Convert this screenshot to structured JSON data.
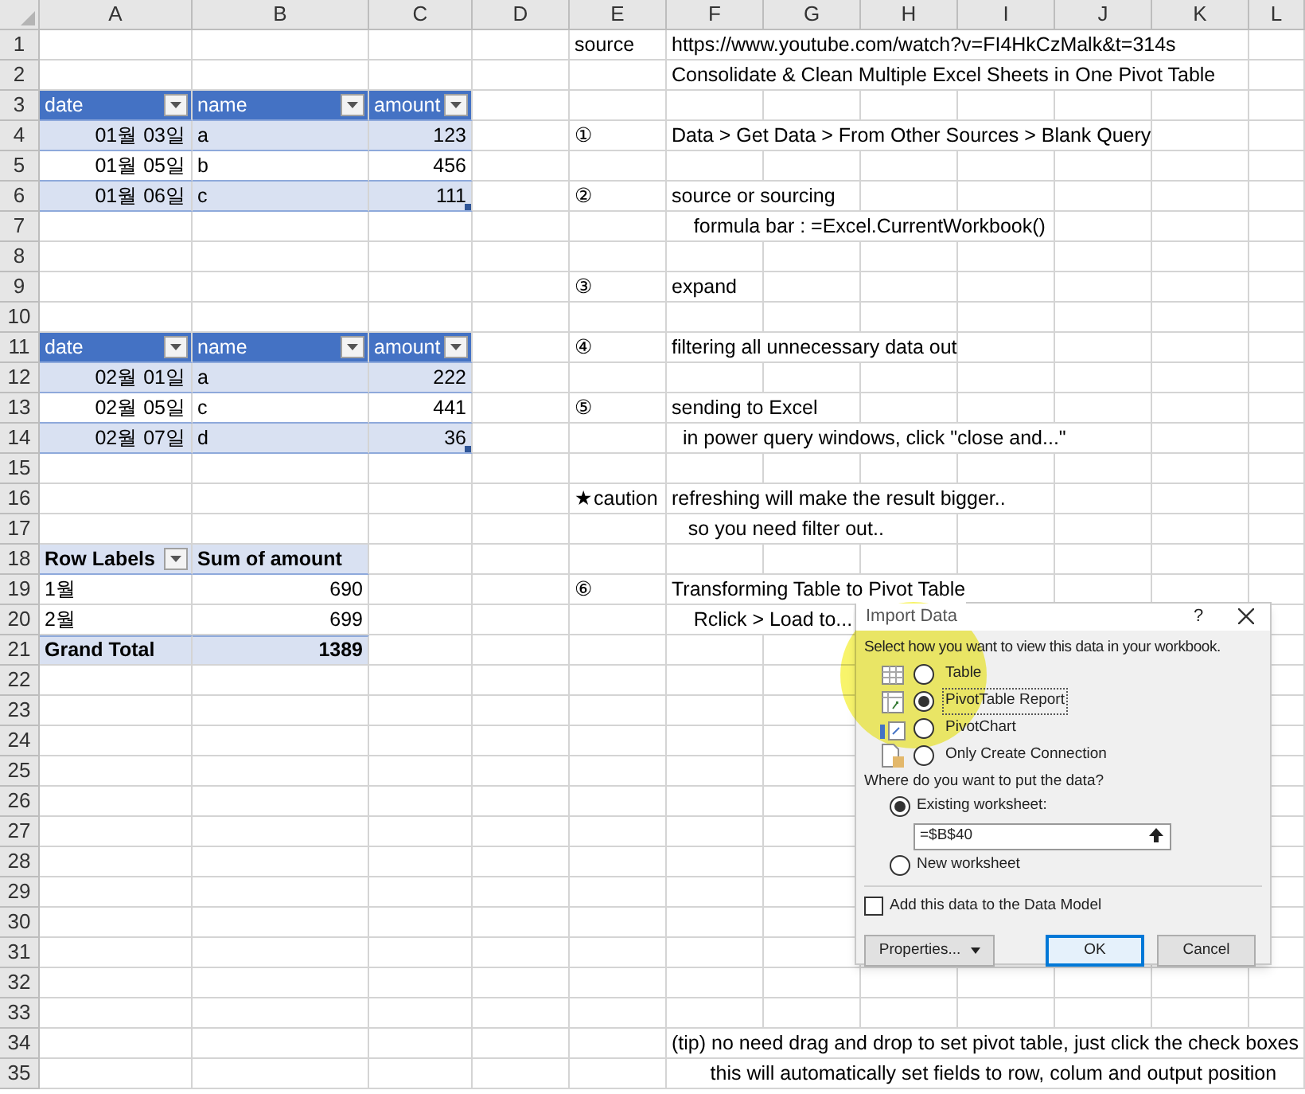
{
  "column_headers": [
    "A",
    "B",
    "C",
    "D",
    "E",
    "F",
    "G",
    "H",
    "I",
    "J",
    "K",
    "L"
  ],
  "row_numbers": [
    "1",
    "2",
    "3",
    "4",
    "5",
    "6",
    "7",
    "8",
    "9",
    "10",
    "11",
    "12",
    "13",
    "14",
    "15",
    "16",
    "17",
    "18",
    "19",
    "20",
    "21",
    "22",
    "23",
    "24",
    "25",
    "26",
    "27",
    "28",
    "29",
    "30",
    "31",
    "32",
    "33",
    "34",
    "35"
  ],
  "tables": [
    {
      "header": [
        {
          "label": "date",
          "filter": true
        },
        {
          "label": "name",
          "filter": true
        },
        {
          "label": "amount",
          "filter": true
        }
      ],
      "rows": [
        [
          "01월 03일",
          "a",
          "123"
        ],
        [
          "01월 05일",
          "b",
          "456"
        ],
        [
          "01월 06일",
          "c",
          "111"
        ]
      ]
    },
    {
      "header": [
        {
          "label": "date",
          "filter": true
        },
        {
          "label": "name",
          "filter": true
        },
        {
          "label": "amount",
          "filter": true
        }
      ],
      "rows": [
        [
          "02월 01일",
          "a",
          "222"
        ],
        [
          "02월 05일",
          "c",
          "441"
        ],
        [
          "02월 07일",
          "d",
          "36"
        ]
      ]
    }
  ],
  "pivot": {
    "header": [
      {
        "label": "Row Labels",
        "filter": true
      },
      {
        "label": "Sum of amount",
        "filter": false
      }
    ],
    "rows": [
      {
        "label": "1월",
        "value": "690"
      },
      {
        "label": "2월",
        "value": "699"
      }
    ],
    "total": {
      "label": "Grand Total",
      "value": "1389"
    }
  },
  "notes": [
    {
      "marker": "source",
      "text": "https://www.youtube.com/watch?v=FI4HkCzMalk&t=314s"
    },
    {
      "text": "Consolidate & Clean Multiple Excel Sheets in One Pivot Table"
    },
    {
      "marker": "①",
      "text": "Data > Get Data > From Other Sources > Blank Query"
    },
    {
      "marker": "②",
      "text": "source or sourcing"
    },
    {
      "text": "    formula bar : =Excel.CurrentWorkbook()"
    },
    {
      "marker": "③",
      "text": "expand"
    },
    {
      "marker": "④",
      "text": "filtering all unnecessary data out"
    },
    {
      "marker": "⑤",
      "text": "sending to Excel"
    },
    {
      "text": "  in power query windows, click \"close and...\""
    },
    {
      "marker": "★caution",
      "text": "refreshing will make the result bigger.."
    },
    {
      "text": "   so you need filter out.."
    },
    {
      "marker": "⑥",
      "text": "Transforming Table to Pivot Table"
    },
    {
      "text": "    Rclick > Load to..."
    },
    {
      "text": "(tip) no need drag and drop to set pivot table, just click the check boxes"
    },
    {
      "text": "       this will automatically set fields to row, colum and output position"
    }
  ],
  "dialog": {
    "title": "Import Data",
    "help": "?",
    "view_prompt": "Select how you want to view this data in your workbook.",
    "view_options": [
      {
        "label": "Table",
        "kind": "table",
        "selected": false
      },
      {
        "label": "PivotTable Report",
        "kind": "pivot-table",
        "selected": true
      },
      {
        "label": "PivotChart",
        "kind": "pivot-chart",
        "selected": false
      },
      {
        "label": "Only Create Connection",
        "kind": "connection",
        "selected": false
      }
    ],
    "location_prompt": "Where do you want to put the data?",
    "location_options": [
      {
        "label": "Existing worksheet:",
        "selected": true,
        "field": {
          "value": "=$B$40"
        }
      },
      {
        "label": "New worksheet",
        "selected": false
      }
    ],
    "data_model": {
      "label": "Add this data to the Data Model",
      "checked": false
    },
    "buttons": [
      {
        "label": "Properties...",
        "kind": "menu"
      },
      {
        "label": "OK",
        "kind": "default"
      },
      {
        "label": "Cancel",
        "kind": "normal"
      }
    ]
  }
}
